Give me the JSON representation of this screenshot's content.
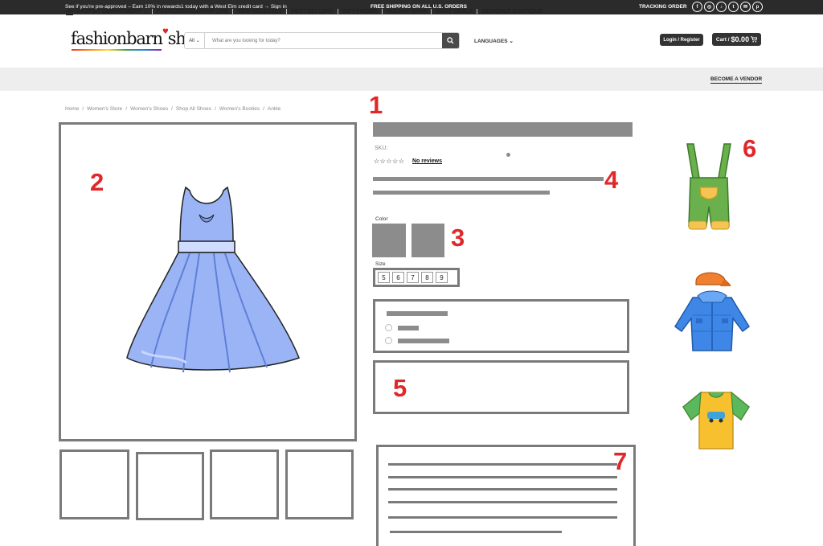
{
  "topbar": {
    "promo": "See if you're pre-approved – Earn 10% in rewards1 today with a West Elm credit card → Sign in",
    "shipping": "FREE SHIPPING ON ALL U.S. ORDERS",
    "tracking": "TRACKING ORDER",
    "social_icons": [
      "facebook-icon",
      "instagram-icon",
      "tiktok-icon",
      "twitter-icon",
      "email-icon",
      "pinterest-icon"
    ],
    "social_glyphs": [
      "f",
      "◎",
      "♪",
      "t",
      "✉",
      "p"
    ]
  },
  "header": {
    "logo_left": "fashionbarn",
    "logo_right": "shop",
    "logo_heart": "♥",
    "search_category": "All",
    "search_placeholder": "What are you looking for today?",
    "languages": "LANGUAGES",
    "login": "Login / Register",
    "cart_label": "Cart /",
    "cart_total": "$0.00"
  },
  "nav": {
    "department": "SHOP BY DEPARTMENT",
    "items": [
      "FASHIONBARNSHOP LIVE",
      "NEW RELEASES",
      "BEST SELLERS",
      "GIFT FINDER",
      "HOLDAY SHOP",
      "DAILY DEALS",
      "DESIGNER BOUTIQUE"
    ],
    "vendor": "BECOME A VENDOR"
  },
  "breadcrumb": [
    "Home",
    "Women's Store",
    "Women's Shoes",
    "Shop All Shoes",
    "Women's Booties",
    "Ankle"
  ],
  "breadcrumb_separator": "/",
  "product": {
    "sku_label": "SKU:",
    "stars": "☆☆☆☆☆",
    "reviews": "No reviews",
    "color_label": "Color",
    "size_label": "Size",
    "sizes": [
      "5",
      "6",
      "7",
      "8",
      "9"
    ]
  },
  "markers": [
    "1",
    "2",
    "3",
    "4",
    "5",
    "6",
    "7"
  ],
  "colors": {
    "marker": "#e0282b",
    "wireframe": "#7a7a7a",
    "dress": "#9bb4f5",
    "topbar": "#2b2b2b"
  }
}
